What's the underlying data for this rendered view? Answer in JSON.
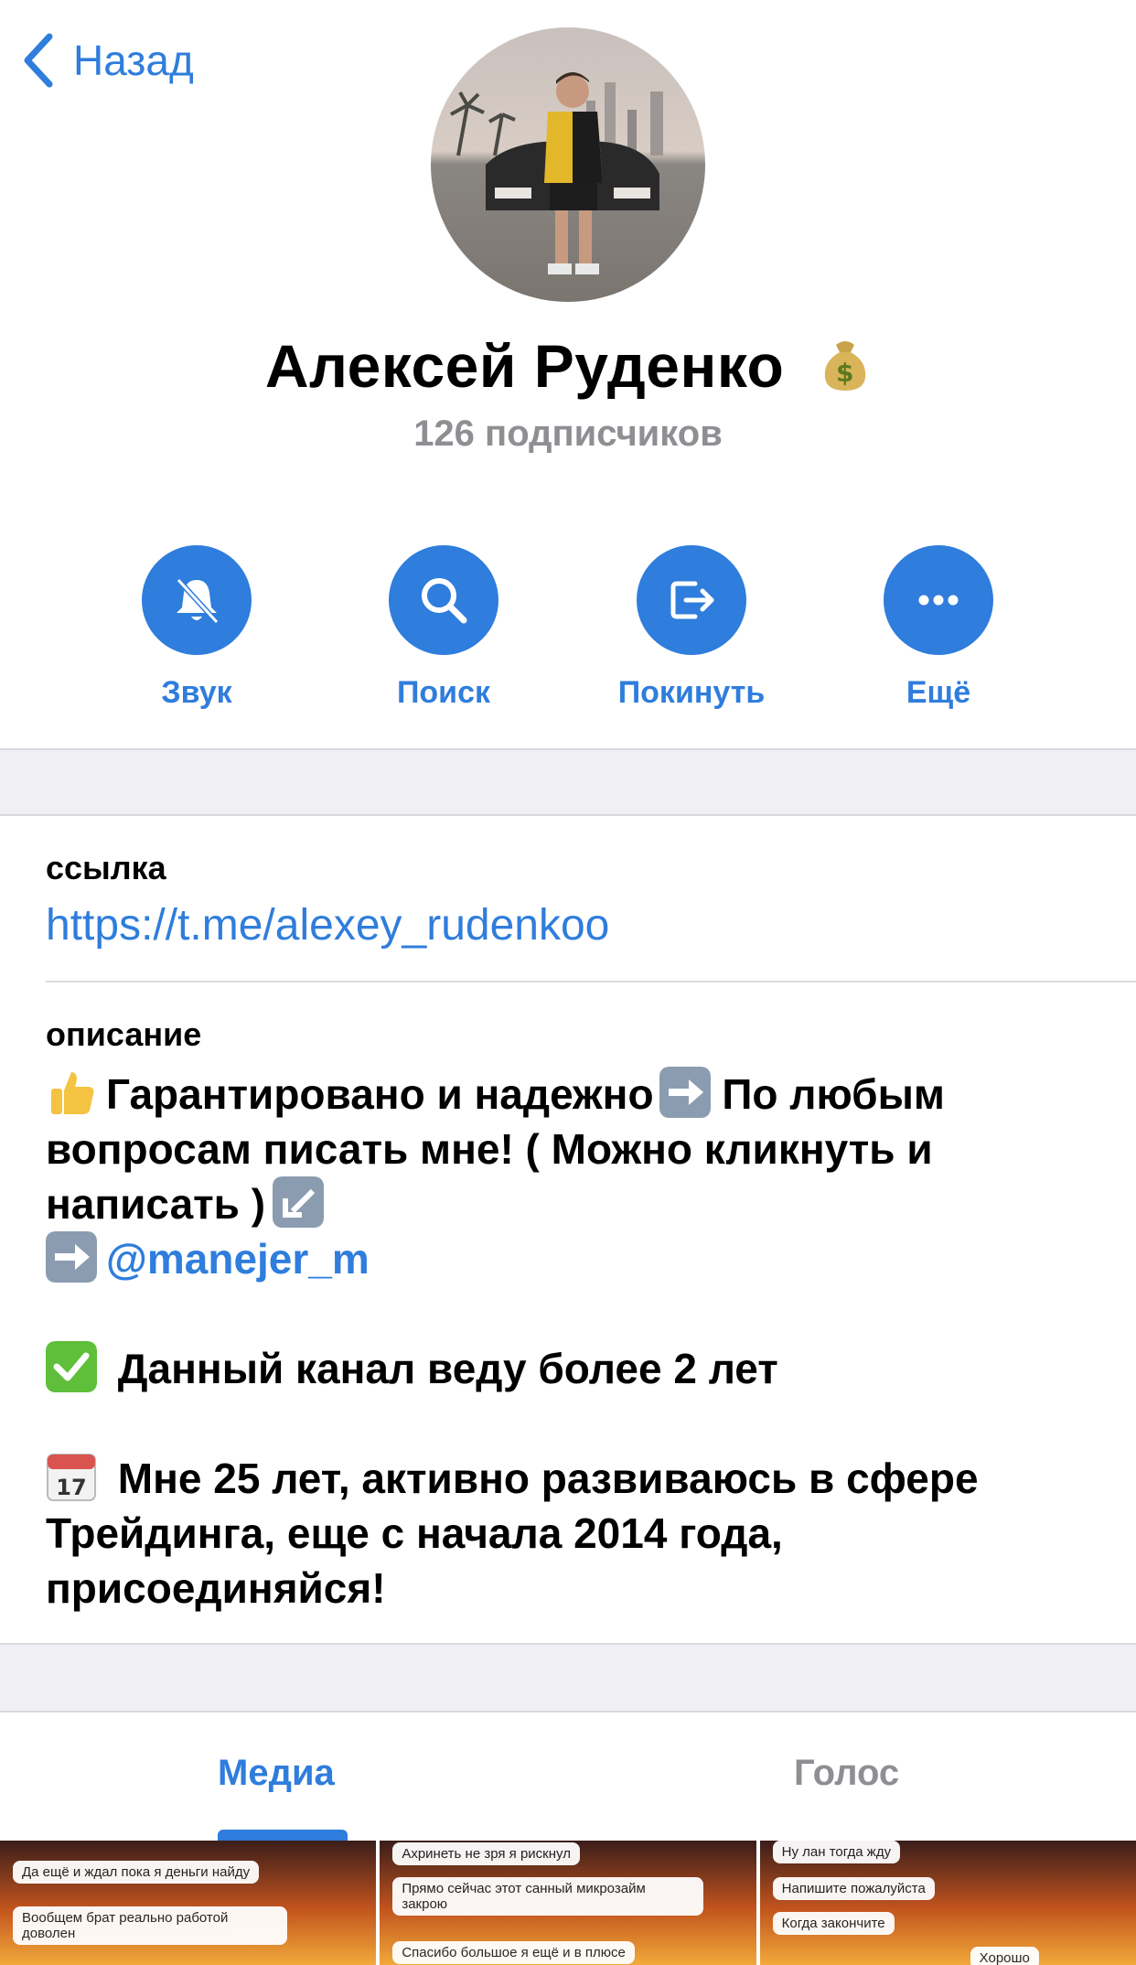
{
  "nav": {
    "back_label": "Назад"
  },
  "profile": {
    "name": "Алексей Руденко",
    "subscribers": "126 подписчиков"
  },
  "actions": [
    {
      "label": "Звук",
      "icon": "bell-muted-icon"
    },
    {
      "label": "Поиск",
      "icon": "search-icon"
    },
    {
      "label": "Покинуть",
      "icon": "leave-icon"
    },
    {
      "label": "Ещё",
      "icon": "more-icon"
    }
  ],
  "info": {
    "link_label": "ссылка",
    "link": "https://t.me/alexey_rudenkoo",
    "description_label": "описание",
    "description": {
      "line1": "Гарантировано и надежно",
      "line1b": " По любым вопросам писать мне! ( Можно кликнуть и написать )",
      "mention": "@manejer_m",
      "line2": " Данный канал веду более 2 лет",
      "line3": " Мне 25 лет, активно развиваюсь в сфере Трейдинга, еще с начала 2014 года, присоединяйся!"
    }
  },
  "tabs": {
    "media": "Медиа",
    "voice": "Голос"
  },
  "media_thumbs": [
    {
      "bubbles": [
        "Да ещё и ждал пока я деньги найду",
        "Вообщем брат реально работой доволен"
      ]
    },
    {
      "bubbles": [
        "Ахринеть не зря я рискнул",
        "Прямо сейчас этот санный микрозайм закрою",
        "Спасибо большое я ещё и в плюсе"
      ]
    },
    {
      "bubbles": [
        "Ну лан тогда жду",
        "Напишите пожалуйста",
        "Когда закончите",
        "Хорошо"
      ]
    }
  ],
  "colors": {
    "accent": "#2f7ddc",
    "secondary_text": "#8e8e93",
    "separator_bg": "#efeff4"
  }
}
